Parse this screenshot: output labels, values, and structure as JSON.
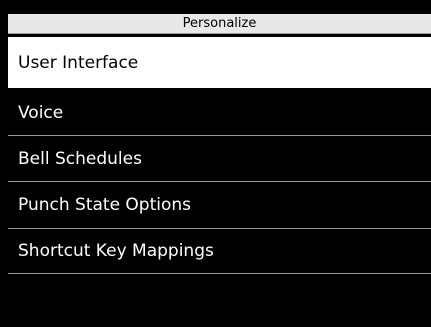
{
  "header": {
    "title": "Personalize"
  },
  "menu": {
    "items": [
      {
        "label": "User Interface",
        "selected": true
      },
      {
        "label": "Voice",
        "selected": false
      },
      {
        "label": "Bell Schedules",
        "selected": false
      },
      {
        "label": "Punch State Options",
        "selected": false
      },
      {
        "label": "Shortcut Key Mappings",
        "selected": false
      }
    ]
  },
  "colors": {
    "background": "#000000",
    "title_bar": "#e8e8e8",
    "selected_bg": "#ffffff",
    "text": "#ffffff",
    "selected_text": "#000000",
    "divider": "#9a9a9a"
  }
}
